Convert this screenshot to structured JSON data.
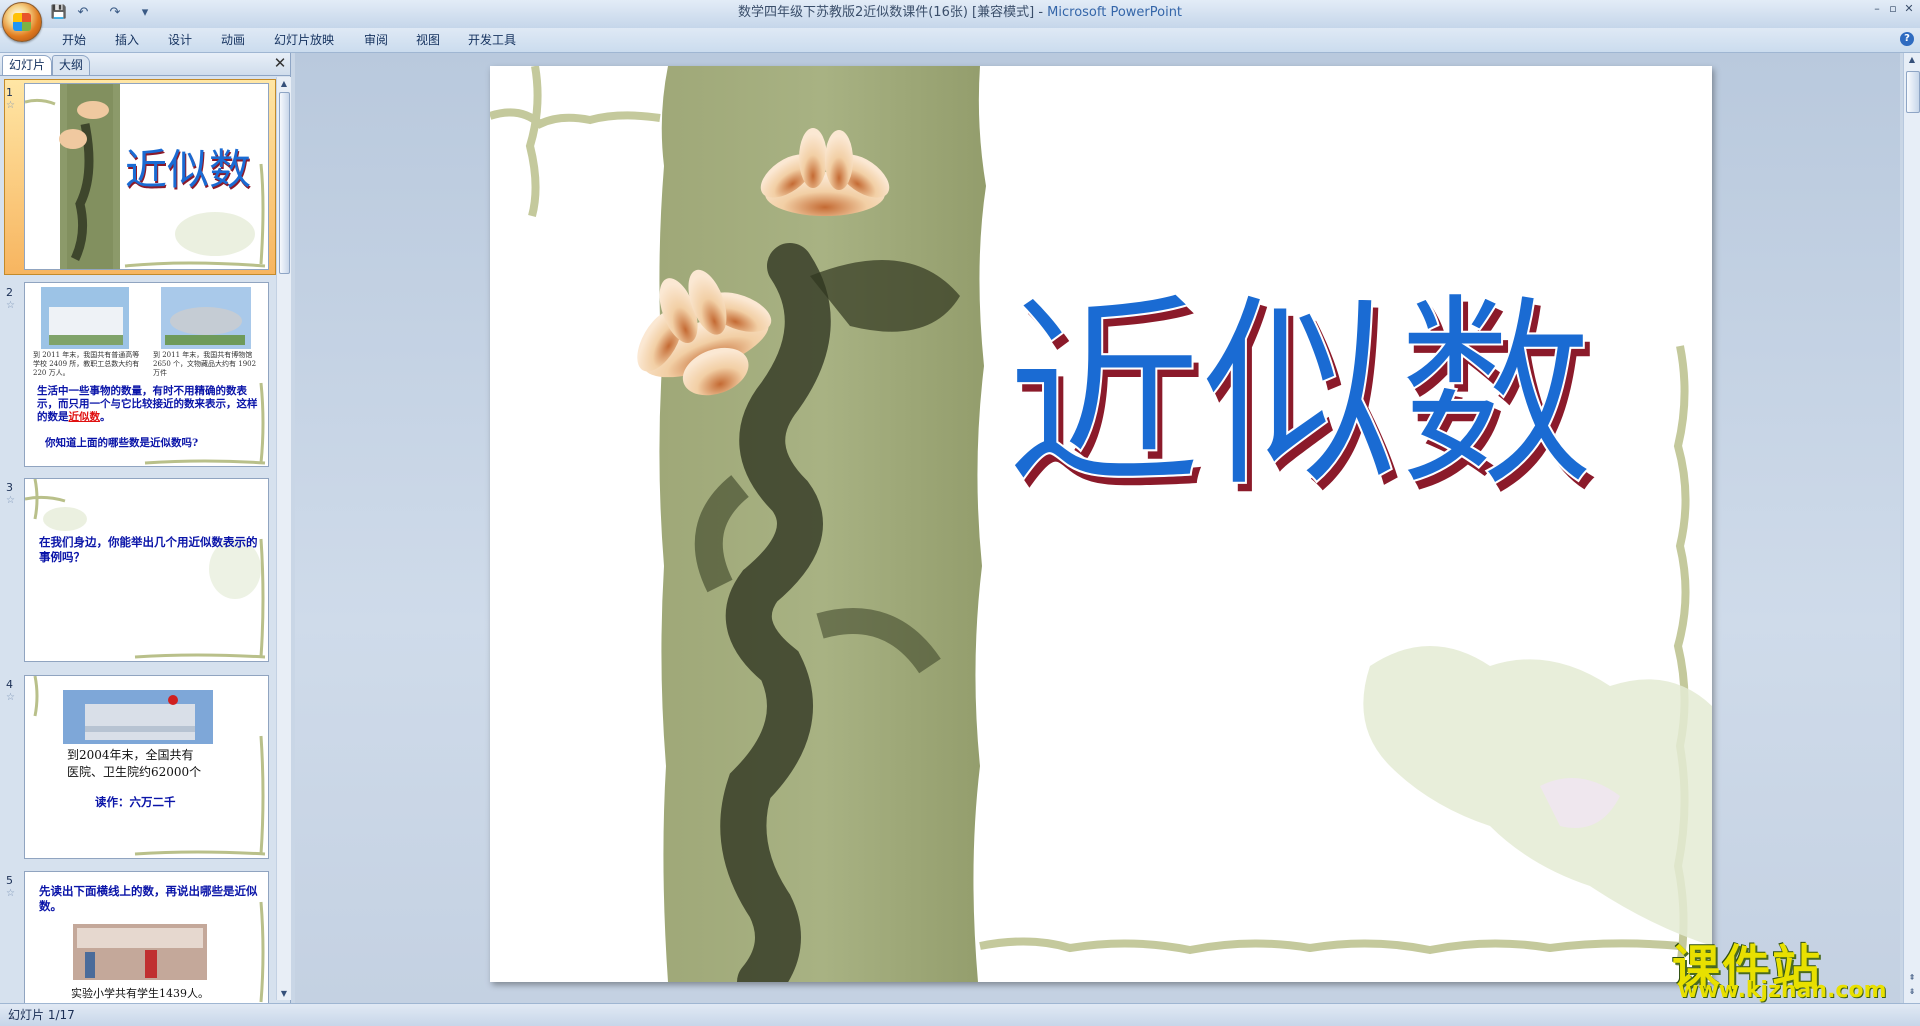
{
  "window": {
    "title": "数学四年级下苏教版2近似数课件(16张) [兼容模式] - ",
    "app_name": "Microsoft PowerPoint",
    "minimize": "–",
    "restore": "▫",
    "close": "✕"
  },
  "qat": {
    "save": "💾",
    "undo": "↶",
    "redo": "↷",
    "customize": "▾"
  },
  "ribbon_tabs": [
    "开始",
    "插入",
    "设计",
    "动画",
    "幻灯片放映",
    "审阅",
    "视图",
    "开发工具"
  ],
  "help": "?",
  "panel": {
    "tab_slides": "幻灯片",
    "tab_outline": "大纲",
    "close": "✕"
  },
  "thumbnails": [
    {
      "num": "1",
      "title": "近似数"
    },
    {
      "num": "2",
      "cap_left": "到 2011 年末，我国共有普通高等学校 2409 所，教职工总数大约有 220 万人。",
      "cap_right": "到 2011 年末，我国共有博物馆 2650 个，文物藏品大约有 1902 万件",
      "text_a": "生活中一些事物的数量，有时不用精确的数表示，而只用一个与它比较接近的数来表示，这样的数是",
      "highlight": "近似数",
      "text_a_end": "。",
      "text_b": "你知道上面的哪些数是近似数吗?"
    },
    {
      "num": "3",
      "text": "在我们身边，你能举出几个用近似数表示的事例吗？"
    },
    {
      "num": "4",
      "line1": "到2004年末，全国共有",
      "line2": "医院、卫生院约62000个",
      "read": "读作：六万二千"
    },
    {
      "num": "5",
      "text": "先读出下面横线上的数，再说出哪些是近似数。",
      "caption": "实验小学共有学生1439人。"
    }
  ],
  "slide": {
    "title": "近似数"
  },
  "status": {
    "slide_counter": "幻灯片 1/17"
  },
  "watermark": {
    "logo": "课件站",
    "url": "www.kjzhan.com"
  },
  "colors": {
    "title_blue": "#1a6bd3",
    "title_shadow": "#8b1a2a",
    "accent_orange": "#f7b560"
  }
}
